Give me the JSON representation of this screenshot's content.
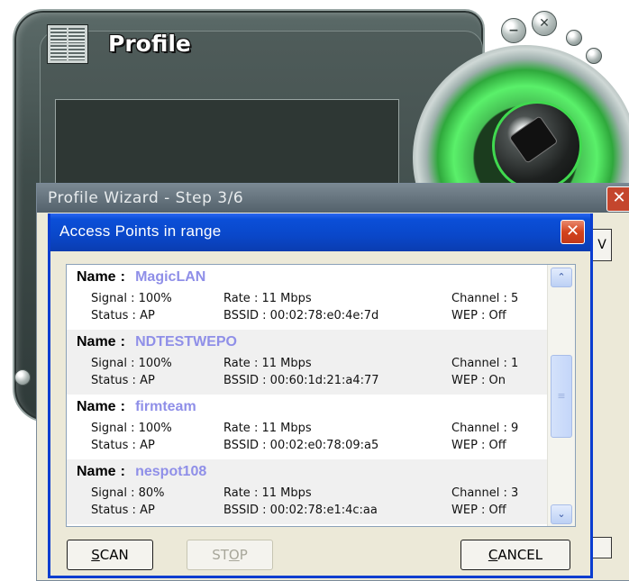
{
  "skin": {
    "title": "Profile",
    "minimize_glyph": "−",
    "close_glyph": "✕"
  },
  "wizard": {
    "title": "Profile Wizard - Step 3/6",
    "close_glyph": "✕",
    "peek_label": "V"
  },
  "dialog": {
    "title": "Access Points in range",
    "close_glyph": "✕",
    "labels": {
      "name": "Name",
      "sep": ":",
      "signal": "Signal",
      "rate": "Rate",
      "channel": "Channel",
      "status": "Status",
      "bssid": "BSSID",
      "wep": "WEP"
    },
    "access_points": [
      {
        "name": "MagicLAN",
        "signal": "Signal : 100%",
        "rate": "Rate : 11 Mbps",
        "channel": "Channel :  5",
        "status": "Status : AP",
        "bssid": "BSSID : 00:02:78:e0:4e:7d",
        "wep": "WEP : Off"
      },
      {
        "name": "NDTESTWEPO",
        "signal": "Signal : 100%",
        "rate": "Rate : 11 Mbps",
        "channel": "Channel :  1",
        "status": "Status : AP",
        "bssid": "BSSID : 00:60:1d:21:a4:77",
        "wep": "WEP : On"
      },
      {
        "name": "firmteam",
        "signal": "Signal : 100%",
        "rate": "Rate : 11 Mbps",
        "channel": "Channel :  9",
        "status": "Status : AP",
        "bssid": "BSSID : 00:02:e0:78:09:a5",
        "wep": "WEP : Off"
      },
      {
        "name": "nespot108",
        "signal": "Signal :  80%",
        "rate": "Rate : 11 Mbps",
        "channel": "Channel :  3",
        "status": "Status : AP",
        "bssid": "BSSID : 00:02:78:e1:4c:aa",
        "wep": "WEP : Off"
      }
    ],
    "scroll": {
      "up_glyph": "⌃",
      "down_glyph": "⌄",
      "thumb_glyph": "≡"
    },
    "buttons": {
      "scan": {
        "key": "S",
        "rest": "CAN"
      },
      "stop": {
        "pre": "ST",
        "key": "O",
        "rest": "P"
      },
      "cancel": {
        "key": "C",
        "rest": "ANCEL"
      }
    }
  }
}
